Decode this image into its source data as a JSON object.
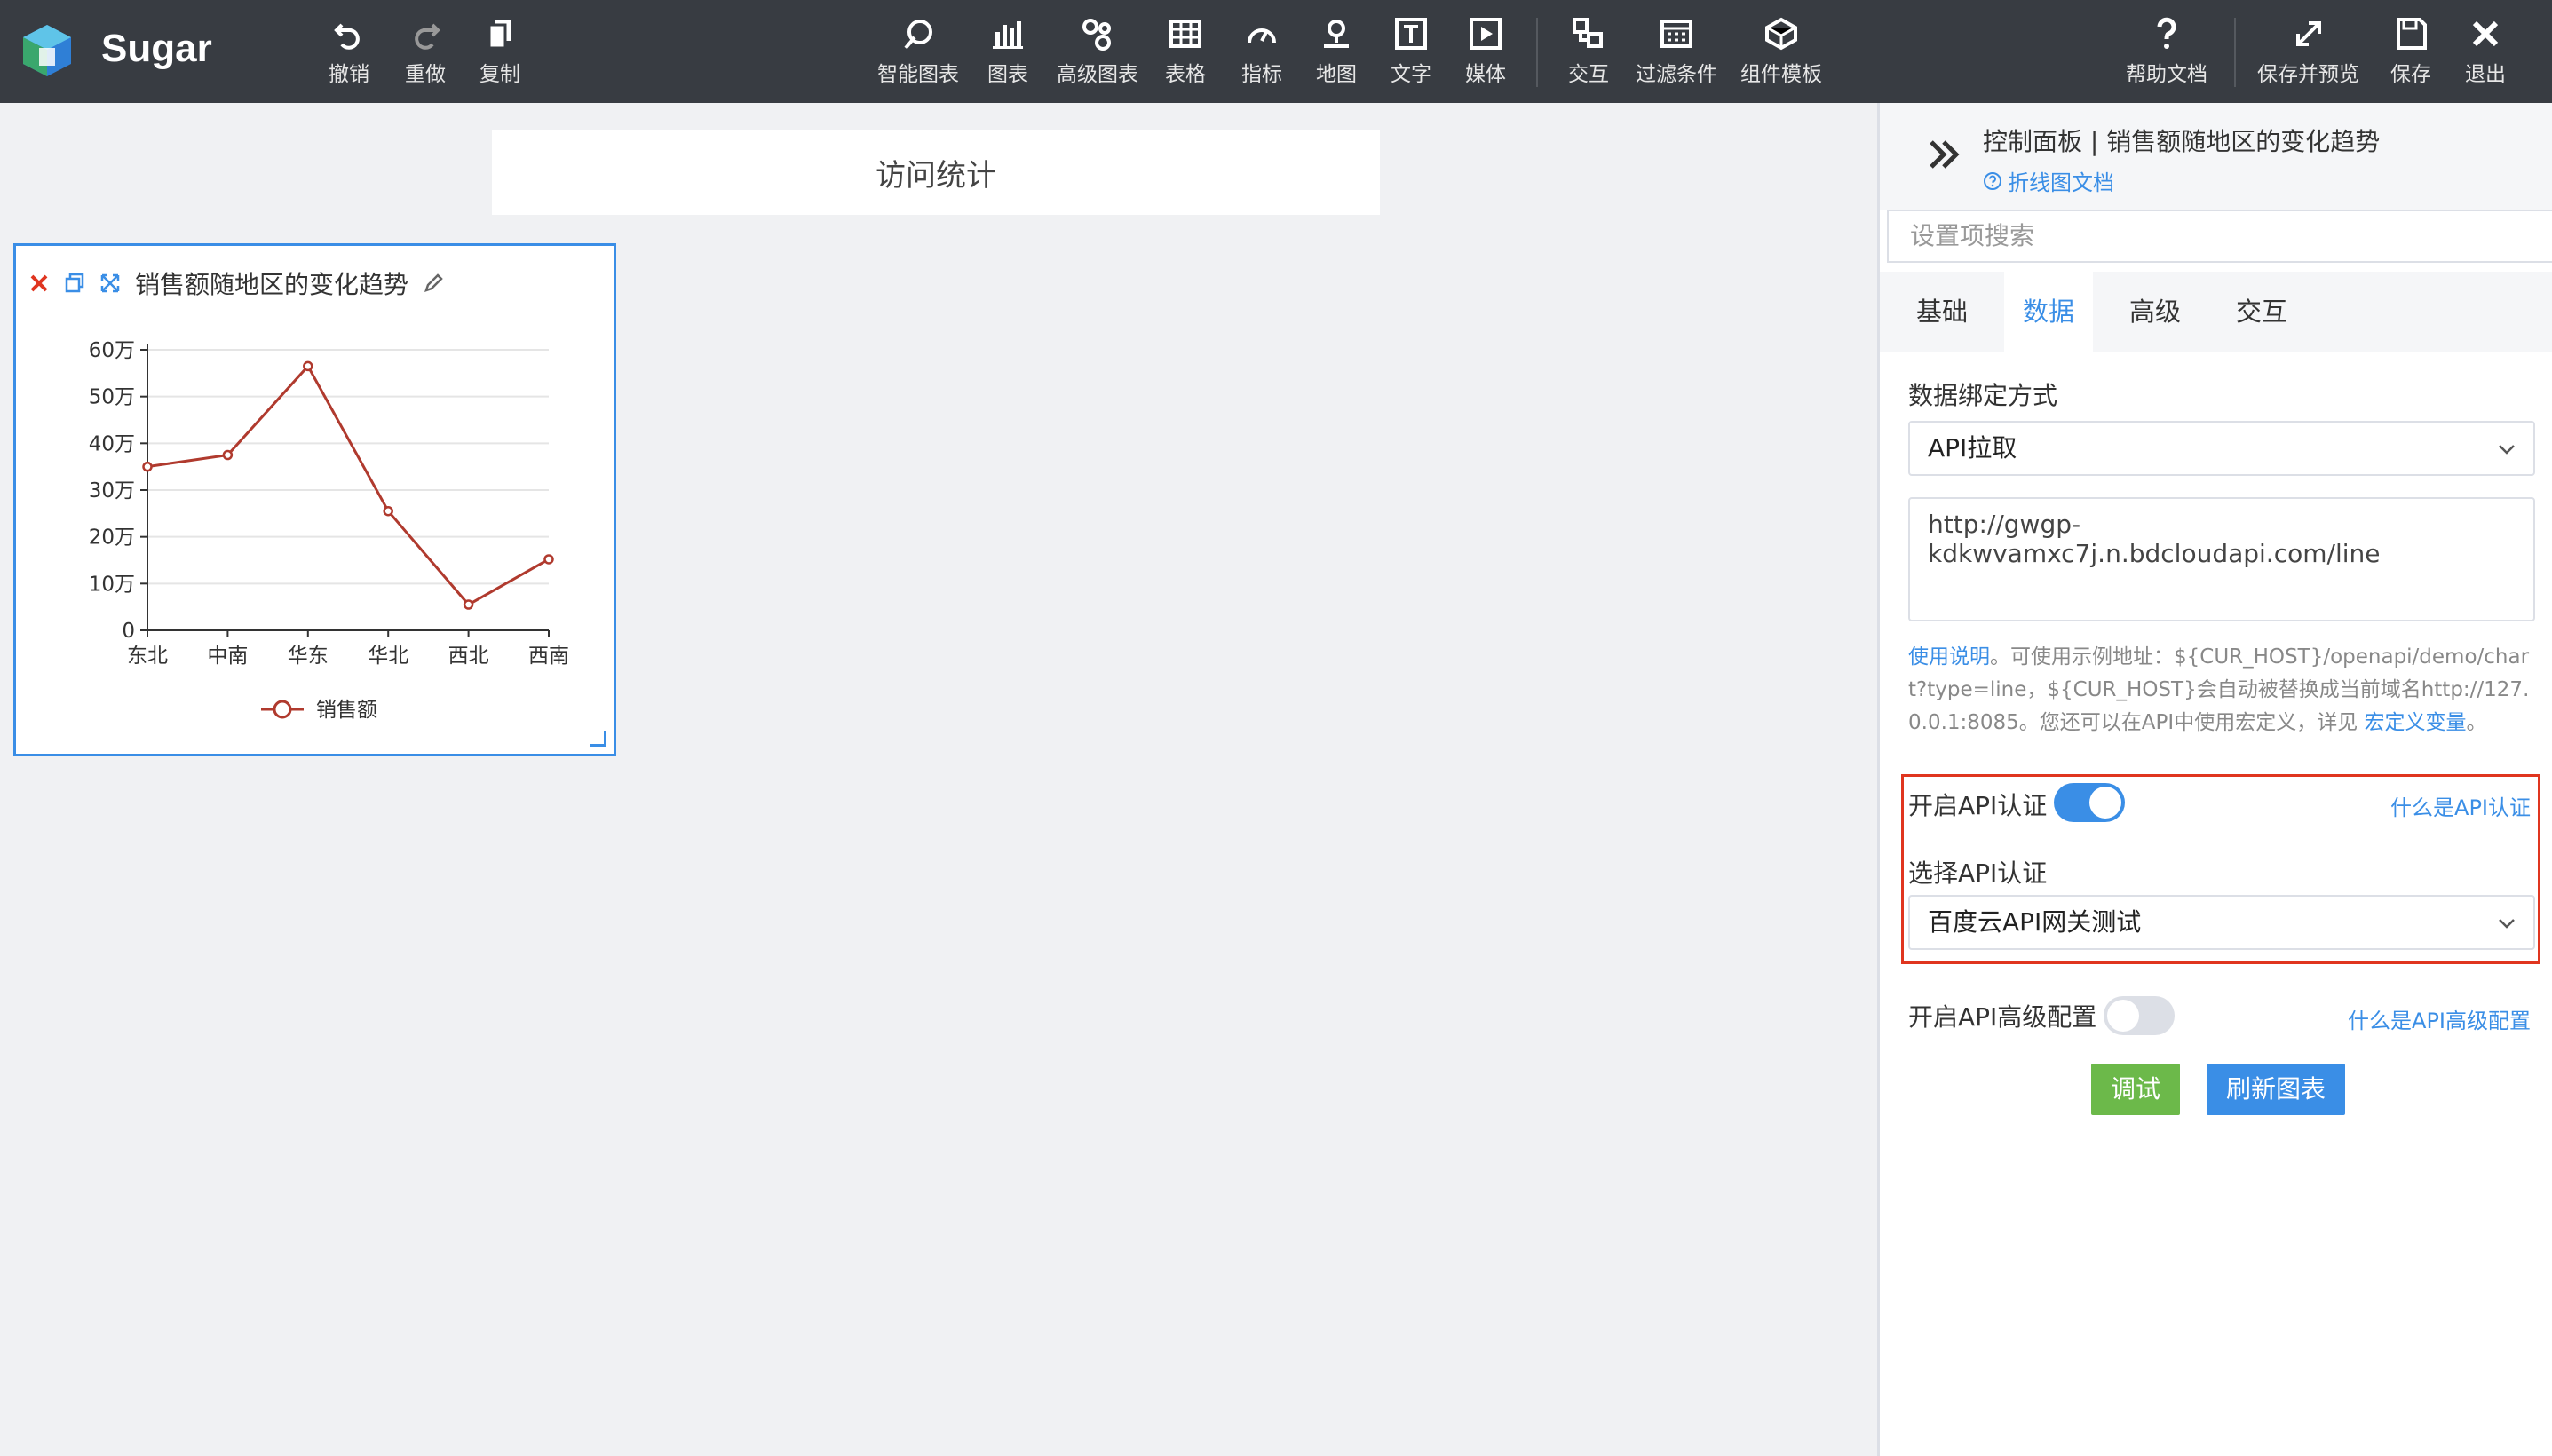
{
  "app": {
    "brand": "Sugar"
  },
  "toolbar": {
    "left": [
      {
        "id": "undo",
        "label": "撤销",
        "icon": "undo-icon"
      },
      {
        "id": "redo",
        "label": "重做",
        "icon": "redo-icon"
      },
      {
        "id": "copy",
        "label": "复制",
        "icon": "copy-icon"
      }
    ],
    "center": [
      {
        "id": "smart-chart",
        "label": "智能图表",
        "icon": "smart-chart-icon"
      },
      {
        "id": "chart",
        "label": "图表",
        "icon": "bar-chart-icon"
      },
      {
        "id": "advanced-chart",
        "label": "高级图表",
        "icon": "advanced-chart-icon"
      },
      {
        "id": "table",
        "label": "表格",
        "icon": "table-icon"
      },
      {
        "id": "indicator",
        "label": "指标",
        "icon": "gauge-icon"
      },
      {
        "id": "map",
        "label": "地图",
        "icon": "map-pin-icon"
      },
      {
        "id": "text",
        "label": "文字",
        "icon": "text-icon"
      },
      {
        "id": "media",
        "label": "媒体",
        "icon": "media-icon"
      },
      {
        "id": "interaction",
        "label": "交互",
        "icon": "interaction-icon"
      },
      {
        "id": "filter",
        "label": "过滤条件",
        "icon": "filter-icon"
      },
      {
        "id": "component-template",
        "label": "组件模板",
        "icon": "component-icon"
      }
    ],
    "right": [
      {
        "id": "help",
        "label": "帮助文档",
        "icon": "question-icon"
      },
      {
        "id": "save-preview",
        "label": "保存并预览",
        "icon": "expand-icon"
      },
      {
        "id": "save",
        "label": "保存",
        "icon": "save-icon"
      },
      {
        "id": "exit",
        "label": "退出",
        "icon": "close-icon"
      }
    ]
  },
  "canvas": {
    "title": "访问统计",
    "chart_card": {
      "title": "销售额随地区的变化趋势"
    }
  },
  "chart_data": {
    "type": "line",
    "categories": [
      "东北",
      "中南",
      "华东",
      "华北",
      "西北",
      "西南"
    ],
    "series": [
      {
        "name": "销售额",
        "values": [
          350000,
          375000,
          565000,
          255000,
          55000,
          152000
        ],
        "color": "#b03a2e"
      }
    ],
    "ylim": [
      0,
      600000
    ],
    "yticks": [
      0,
      100000,
      200000,
      300000,
      400000,
      500000,
      600000
    ],
    "ytick_labels": [
      "0",
      "10万",
      "20万",
      "30万",
      "40万",
      "50万",
      "60万"
    ],
    "legend": "bottom-center",
    "grid": true
  },
  "panel": {
    "title": "控制面板 | 销售额随地区的变化趋势",
    "doc_link": "折线图文档",
    "search_placeholder": "设置项搜索",
    "tabs": [
      "基础",
      "数据",
      "高级",
      "交互"
    ],
    "active_tab": "数据",
    "binding_label": "数据绑定方式",
    "binding_value": "API拉取",
    "api_url": "http://gwgp-kdkwvamxc7j.n.bdcloudapi.com/line",
    "help": {
      "link1": "使用说明",
      "text1": "。可使用示例地址：${CUR_HOST}/openapi/demo/chart?type=line，${CUR_HOST}会自动被替换成当前域名http://127.0.0.1:8085。您还可以在API中使用宏定义，详见 ",
      "link2": "宏定义变量",
      "text2": "。"
    },
    "auth_toggle_label": "开启API认证",
    "auth_toggle_on": true,
    "auth_what": "什么是API认证",
    "auth_select_label": "选择API认证",
    "auth_select_value": "百度云API网关测试",
    "advanced_toggle_label": "开启API高级配置",
    "advanced_toggle_on": false,
    "advanced_what": "什么是API高级配置",
    "debug_button": "调试",
    "refresh_button": "刷新图表"
  }
}
